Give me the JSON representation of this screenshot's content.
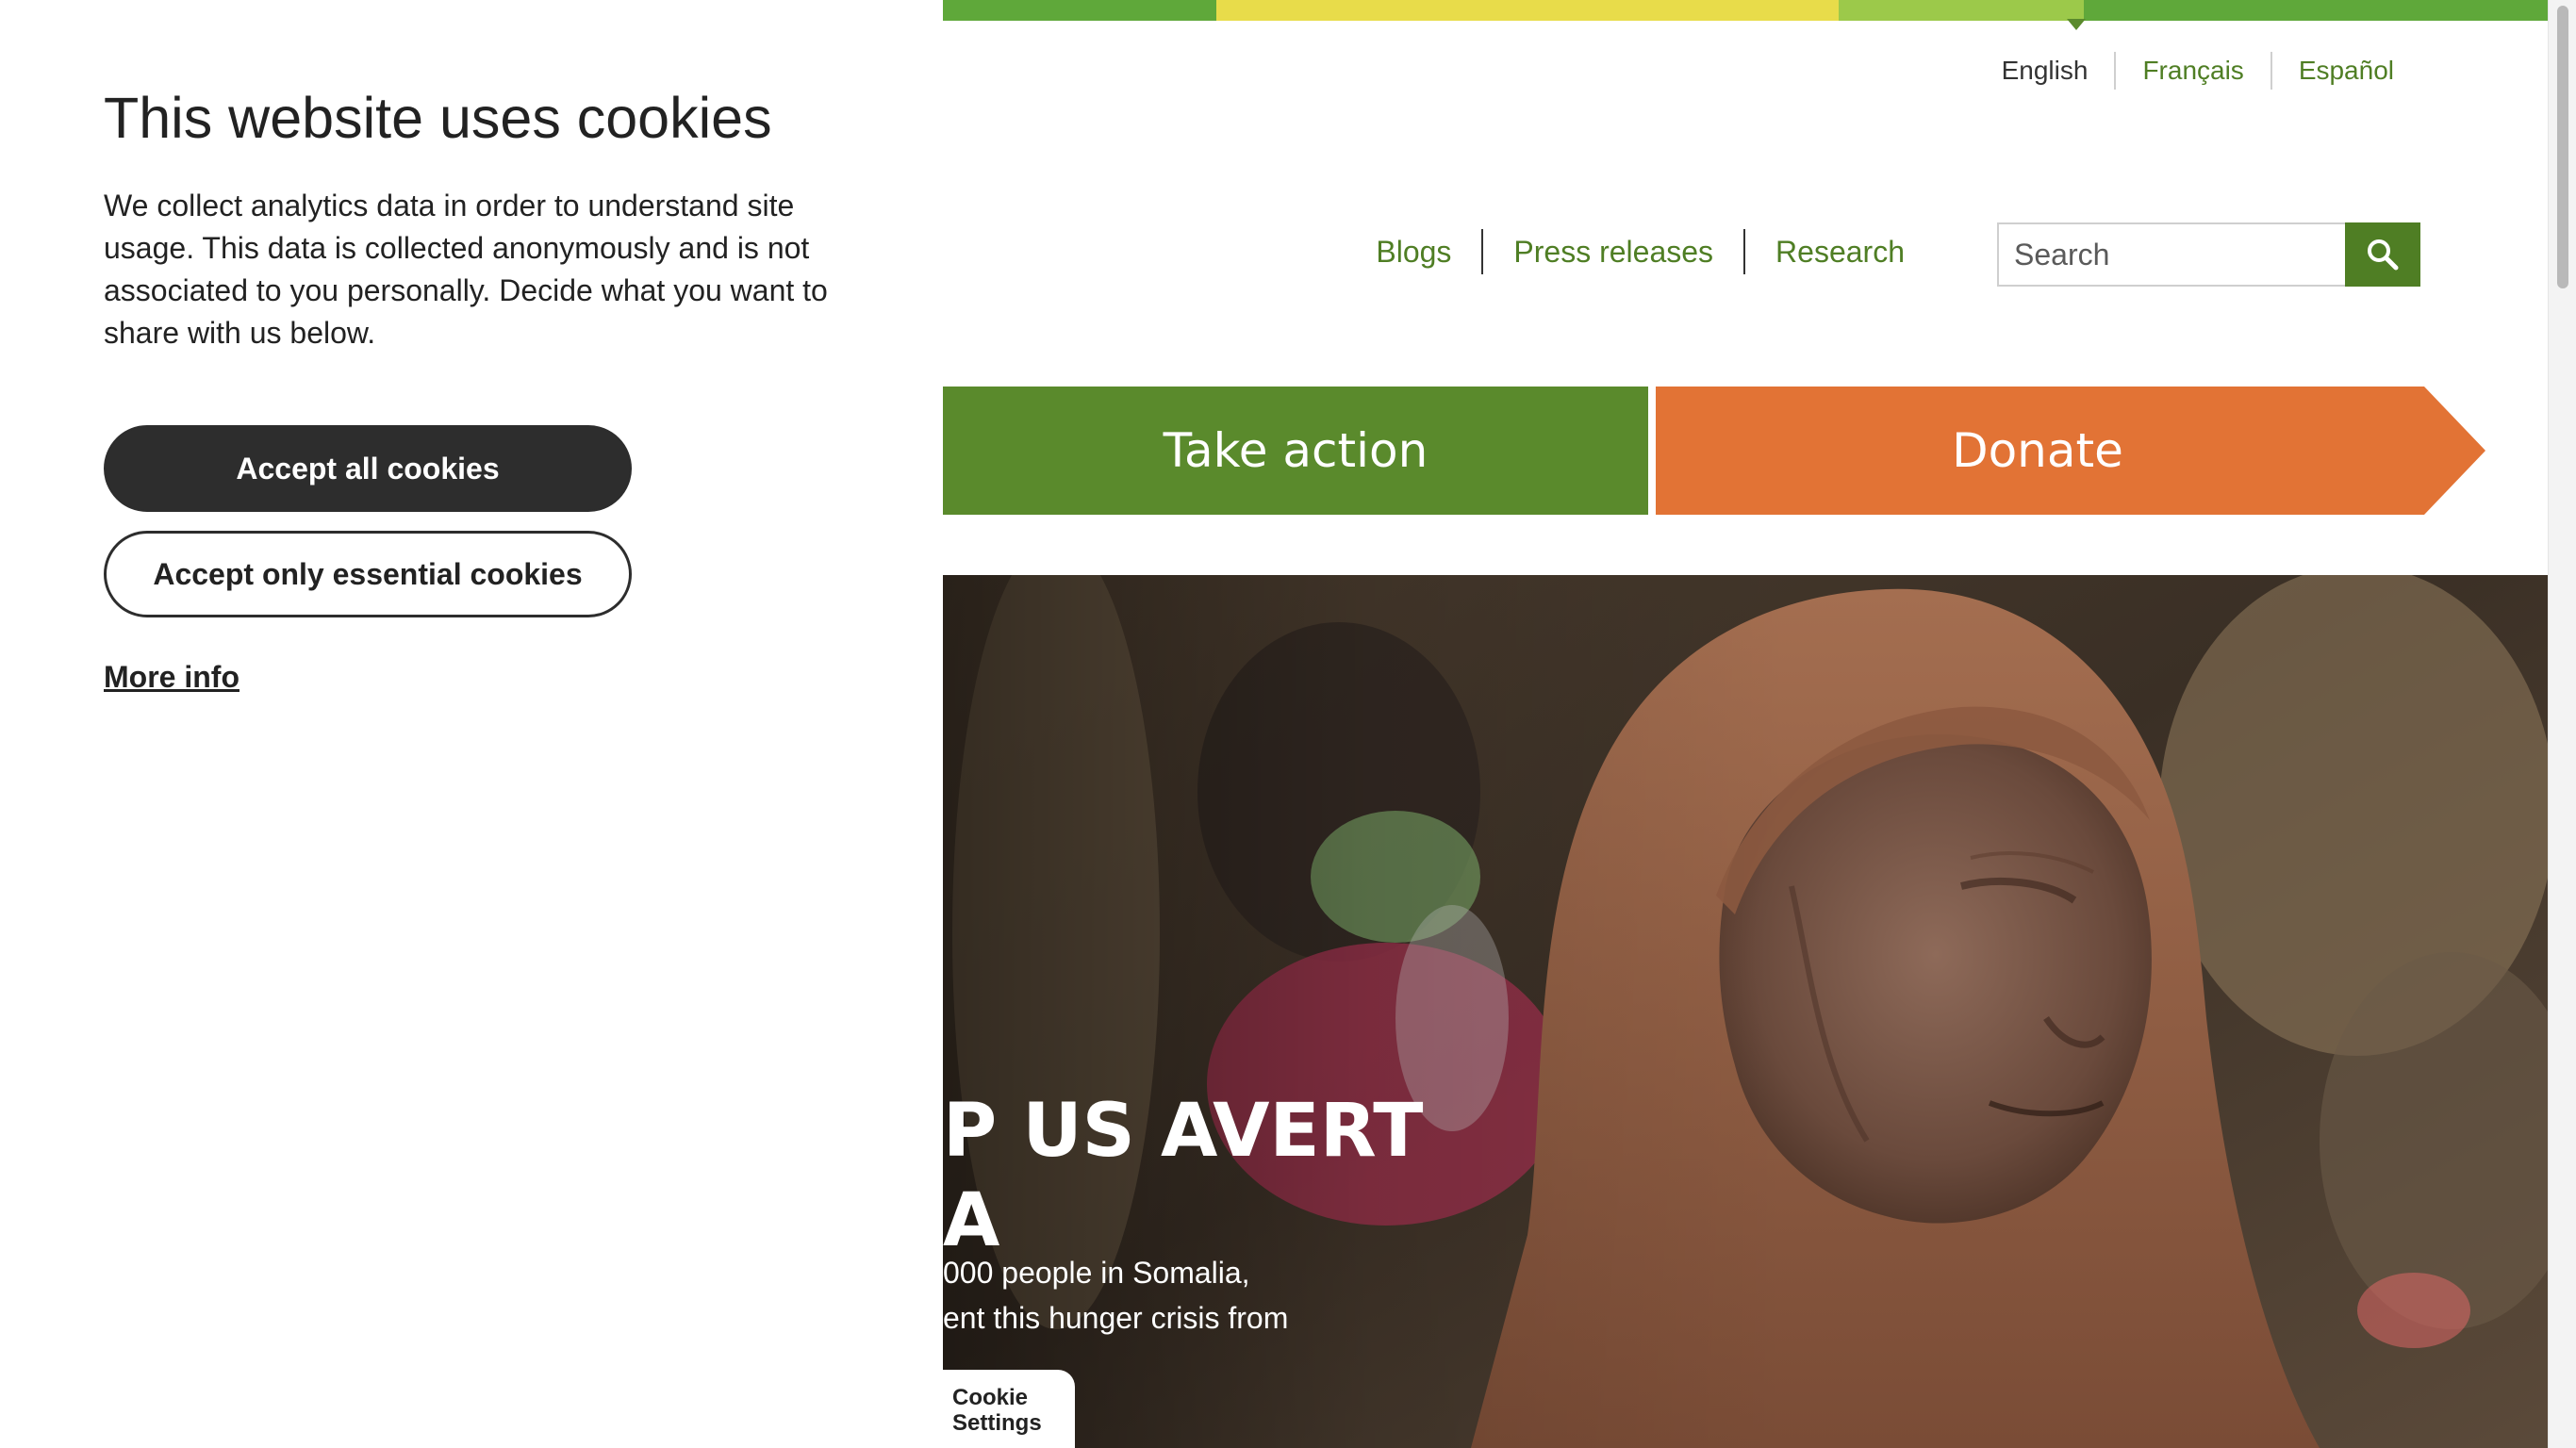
{
  "cookie_banner": {
    "title": "This website uses cookies",
    "description": "We collect analytics data in order to understand site usage. This data is collected anonymously and is not associated to you personally. Decide what you want to share with us below.",
    "accept_all_label": "Accept all cookies",
    "accept_essential_label": "Accept only essential cookies",
    "more_info_label": "More info"
  },
  "languages": {
    "active": "English",
    "others": [
      "Français",
      "Español"
    ]
  },
  "utility_nav": [
    "Blogs",
    "Press releases",
    "Research"
  ],
  "search": {
    "placeholder": "Search",
    "icon": "search-icon"
  },
  "cta": {
    "take_action": "Take action",
    "donate": "Donate"
  },
  "hero": {
    "headline_line1": "P US AVERT",
    "headline_line2": "A",
    "body_line1": "000 people in Somalia,",
    "body_line2": "ent this hunger crisis from"
  },
  "cookie_settings": {
    "line1": "Cookie",
    "line2": "Settings"
  },
  "colors": {
    "brand_green": "#5a8a2c",
    "link_green": "#4f7e24",
    "donate_orange": "#e27335",
    "stripe_yellow": "#e8dc4a",
    "stripe_lime": "#9cc94a",
    "dark_button": "#2d2d2d"
  }
}
